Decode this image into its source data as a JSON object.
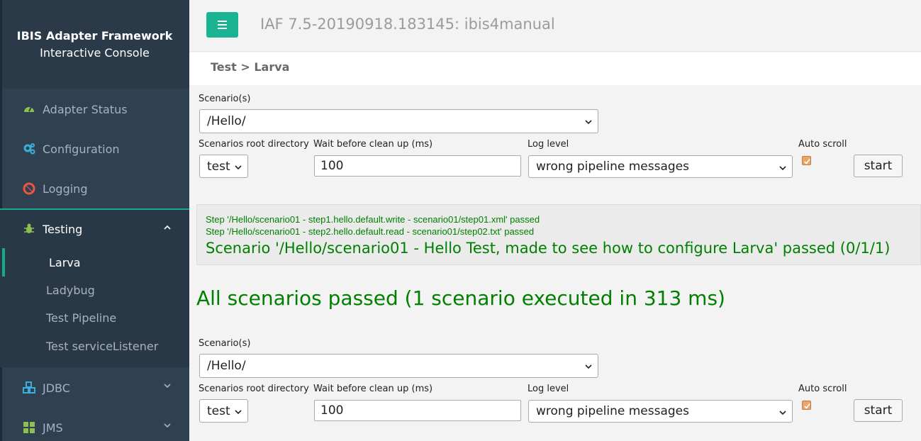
{
  "brand": {
    "title": "IBIS Adapter Framework",
    "subtitle": "Interactive Console"
  },
  "app_title": "IAF 7.5-20190918.183145: ibis4manual",
  "breadcrumb": "Test > Larva",
  "sidebar": {
    "items": [
      {
        "label": "Adapter Status",
        "icon": "tachometer-icon"
      },
      {
        "label": "Configuration",
        "icon": "cogs-icon"
      },
      {
        "label": "Logging",
        "icon": "lifebuoy-icon"
      },
      {
        "label": "Testing",
        "icon": "bug-icon"
      },
      {
        "label": "JDBC",
        "icon": "cubes-icon"
      },
      {
        "label": "JMS",
        "icon": "th-large-icon"
      }
    ],
    "testing_sub": [
      {
        "label": "Larva"
      },
      {
        "label": "Ladybug"
      },
      {
        "label": "Test Pipeline"
      },
      {
        "label": "Test serviceListener"
      }
    ]
  },
  "form": {
    "scenarios_label": "Scenario(s)",
    "scenarios_value": "/Hello/",
    "root_dir_label": "Scenarios root directory",
    "root_dir_value": "test",
    "wait_label": "Wait before clean up (ms)",
    "wait_value": "100",
    "log_level_label": "Log level",
    "log_level_value": "wrong pipeline messages",
    "auto_scroll_label": "Auto scroll",
    "auto_scroll_checked": true,
    "start_label": "start"
  },
  "results": {
    "steps": [
      "Step '/Hello/scenario01 - step1.hello.default.write - scenario01/step01.xml' passed",
      "Step '/Hello/scenario01 - step2.hello.default.read - scenario01/step02.txt' passed"
    ],
    "scenario": "Scenario '/Hello/scenario01 - Hello Test, made to see how to configure Larva' passed (0/1/1)",
    "summary": "All scenarios passed (1 scenario executed in 313 ms)"
  },
  "colors": {
    "accent": "#1ab394",
    "sidebar": "#2f4050",
    "pass": "#008000"
  }
}
